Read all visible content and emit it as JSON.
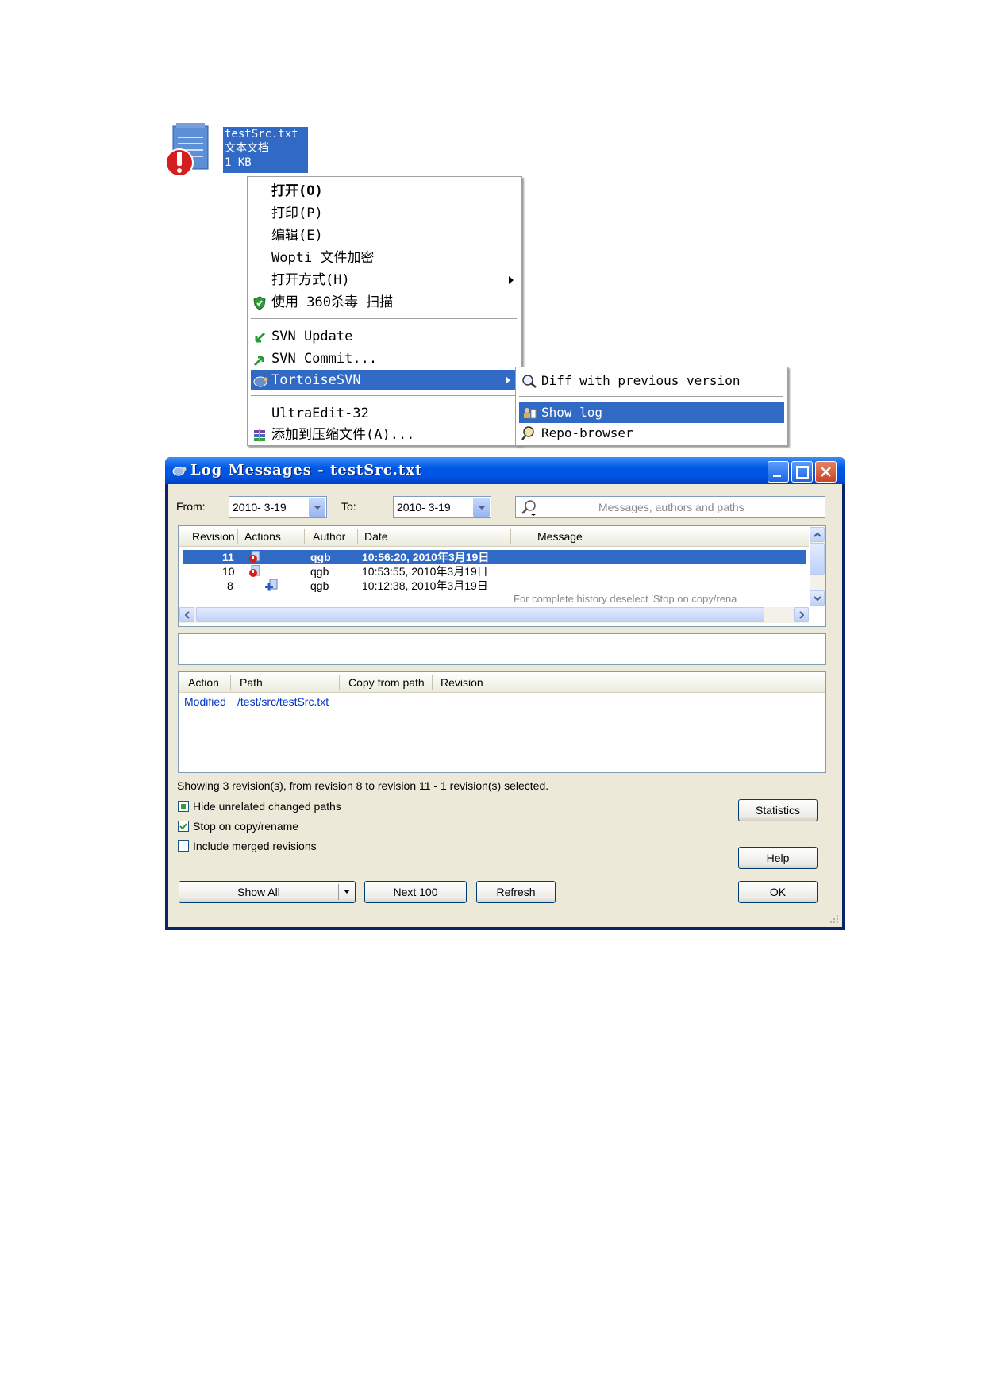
{
  "file": {
    "name": "testSrc.txt",
    "type": "文本文档",
    "size": "1 KB"
  },
  "context_menu": {
    "items": [
      {
        "label": "打开(O)"
      },
      {
        "label": "打印(P)"
      },
      {
        "label": "编辑(E)"
      },
      {
        "label": "Wopti 文件加密"
      },
      {
        "label": "打开方式(H)"
      },
      {
        "label": "使用 360杀毒 扫描"
      },
      {
        "label": "SVN Update"
      },
      {
        "label": "SVN Commit..."
      },
      {
        "label": "TortoiseSVN"
      },
      {
        "label": "UltraEdit-32"
      },
      {
        "label": "添加到压缩文件(A)..."
      }
    ]
  },
  "submenu": {
    "items": [
      {
        "label": "Diff with previous version"
      },
      {
        "label": "Show log"
      },
      {
        "label": "Repo-browser"
      }
    ]
  },
  "log_window": {
    "title": "Log Messages - testSrc.txt",
    "from_label": "From:",
    "from_value": "2010- 3-19",
    "to_label": "To:",
    "to_value": "2010- 3-19",
    "search_placeholder": "Messages, authors and paths",
    "revision_columns": [
      "Revision",
      "Actions",
      "Author",
      "Date",
      "Message"
    ],
    "revisions": [
      {
        "revision": "11",
        "author": "qgb",
        "date": "10:56:20, 2010年3月19日",
        "selected": true
      },
      {
        "revision": "10",
        "author": "qgb",
        "date": "10:53:55, 2010年3月19日",
        "selected": false
      },
      {
        "revision": "8",
        "author": "qgb",
        "date": "10:12:38, 2010年3月19日",
        "selected": false
      }
    ],
    "hint_text": "For complete history deselect 'Stop on copy/rena",
    "path_columns": [
      "Action",
      "Path",
      "Copy from path",
      "Revision"
    ],
    "paths": [
      {
        "action": "Modified",
        "path": "/test/src/testSrc.txt"
      }
    ],
    "status_text": "Showing 3 revision(s), from revision 8 to revision 11 - 1 revision(s) selected.",
    "checkboxes": [
      {
        "label": "Hide unrelated changed paths",
        "state": "indeterminate"
      },
      {
        "label": "Stop on copy/rename",
        "state": "checked"
      },
      {
        "label": "Include merged revisions",
        "state": "unchecked"
      }
    ],
    "buttons": {
      "show_all": "Show All",
      "next_100": "Next 100",
      "refresh": "Refresh",
      "statistics": "Statistics",
      "help": "Help",
      "ok": "OK"
    }
  },
  "colors": {
    "selection": "#316ac5",
    "titlebar": "#0054e3",
    "dialog_bg": "#ece9d8",
    "link_blue": "#0033cc"
  }
}
